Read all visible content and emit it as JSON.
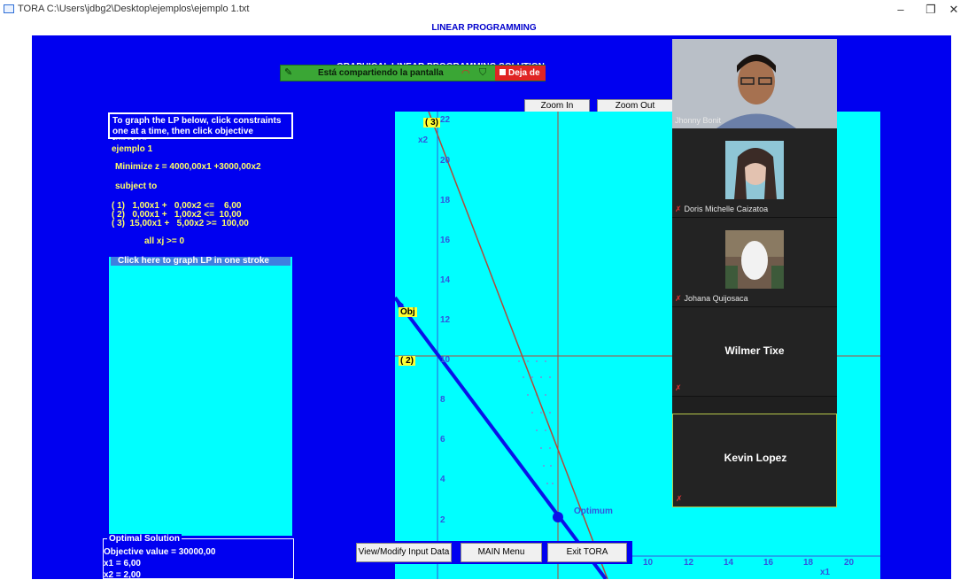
{
  "window": {
    "title": "TORA C:\\Users\\jdbg2\\Desktop\\ejemplos\\ejemplo 1.txt",
    "controls": [
      "–",
      "❐",
      "✕"
    ]
  },
  "app": {
    "banner": "LINEAR PROGRAMMING",
    "heading": "GRAPHICAL LINEAR PROGRAMMING SOLUTION",
    "heading_visible_part": "SOLUTION"
  },
  "share_bar": {
    "message": "Está compartiendo la pantalla",
    "stop_label": "Deja de"
  },
  "instructions": "To graph the LP below, click constraints one at a time, then click objective function",
  "lp": {
    "name": "ejemplo 1",
    "objective": "Minimize z = 4000,00x1 +3000,00x2",
    "subject_to": "subject to",
    "constraints": [
      "( 1)   1,00x1 +   0,00x2 <=    6,00",
      "( 2)   0,00x1 +   1,00x2 <=  10,00",
      "( 3)  15,00x1 +   5,00x2 >=  100,00"
    ],
    "nonneg": "all xj >= 0",
    "one_stroke": "Click here to graph LP in one stroke"
  },
  "optimal": {
    "header": "Optimal Solution",
    "objective_value": "Objective value = 30000,00",
    "x1": "x1 = 6,00",
    "x2": "x2 = 2,00"
  },
  "buttons": {
    "zoom_in": "Zoom In",
    "zoom_out": "Zoom Out",
    "view_modify": "View/Modify Input Data",
    "main_menu": "MAIN Menu",
    "exit": "Exit TORA"
  },
  "graph": {
    "y_ticks": [
      "2",
      "4",
      "6",
      "8",
      "10",
      "12",
      "14",
      "16",
      "18",
      "20",
      "22"
    ],
    "x_ticks": [
      "10",
      "12",
      "14",
      "16",
      "18",
      "20"
    ],
    "xlabel": "x1",
    "ylabel": "x2",
    "labels": {
      "c3": "( 3)",
      "c2": "( 2)",
      "obj": "Obj",
      "optimum": "Optimum"
    }
  },
  "participants": [
    {
      "name": "Jhonny Bonit"
    },
    {
      "name": "Doris Michelle Caizatoa"
    },
    {
      "name": "Johana Quijosaca"
    },
    {
      "name": "Wilmer Tixe"
    },
    {
      "name": "Kevin Lopez"
    }
  ]
}
